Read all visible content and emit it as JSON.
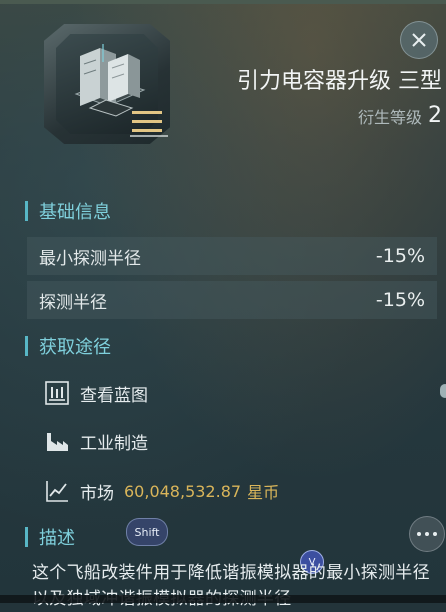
{
  "item": {
    "name": "引力电容器升级 三型",
    "meta_label": "衍生等级",
    "meta_value": "2",
    "icon": "module-icon",
    "tier_badge": "tier-3-icon"
  },
  "buttons": {
    "close": "close-icon",
    "more": "more-icon"
  },
  "sections": {
    "basic": "基础信息",
    "acquire": "获取途径",
    "description": "描述"
  },
  "attributes": [
    {
      "label": "最小探测半径",
      "value": "-15%"
    },
    {
      "label": "探测半径",
      "value": "-15%"
    }
  ],
  "acquire": {
    "blueprint": {
      "label": "查看蓝图",
      "icon": "blueprint-icon"
    },
    "industry": {
      "label": "工业制造",
      "icon": "factory-icon"
    },
    "market": {
      "label": "市场",
      "price": "60,048,532.87",
      "currency": "星币",
      "icon": "market-chart-icon"
    }
  },
  "description": {
    "text": "这个飞船改装件用于降低谐振模拟器的最小探测半径以及独域冲谐振模拟器的探测半径"
  },
  "overlays": {
    "shift": "Shift",
    "v": "V"
  },
  "colors": {
    "accent": "#7fd0dc",
    "price": "#d9b55a"
  }
}
